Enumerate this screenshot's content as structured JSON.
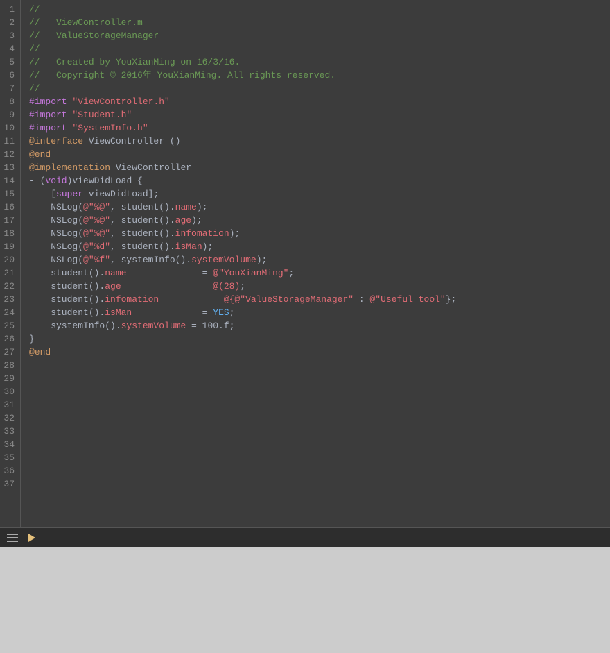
{
  "editor": {
    "background": "#3c3c3c",
    "lines": [
      {
        "num": 1,
        "tokens": [
          {
            "t": "//",
            "c": "comment"
          }
        ]
      },
      {
        "num": 2,
        "tokens": [
          {
            "t": "//   ViewController.m",
            "c": "comment"
          }
        ]
      },
      {
        "num": 3,
        "tokens": [
          {
            "t": "//   ValueStorageManager",
            "c": "comment"
          }
        ]
      },
      {
        "num": 4,
        "tokens": [
          {
            "t": "//",
            "c": "comment"
          }
        ]
      },
      {
        "num": 5,
        "tokens": [
          {
            "t": "//   Created by YouXianMing on 16/3/16.",
            "c": "comment"
          }
        ]
      },
      {
        "num": 6,
        "tokens": [
          {
            "t": "//   Copyright © 2016年 YouXianMing. All rights reserved.",
            "c": "comment"
          }
        ]
      },
      {
        "num": 7,
        "tokens": [
          {
            "t": "//",
            "c": "comment"
          }
        ]
      },
      {
        "num": 8,
        "tokens": [
          {
            "t": "",
            "c": "plain"
          }
        ]
      },
      {
        "num": 9,
        "tokens": [
          {
            "t": "#import",
            "c": "directive"
          },
          {
            "t": " ",
            "c": "plain"
          },
          {
            "t": "\"ViewController.h\"",
            "c": "string"
          }
        ]
      },
      {
        "num": 10,
        "tokens": [
          {
            "t": "#import",
            "c": "directive"
          },
          {
            "t": " ",
            "c": "plain"
          },
          {
            "t": "\"Student.h\"",
            "c": "string"
          }
        ]
      },
      {
        "num": 11,
        "tokens": [
          {
            "t": "#import",
            "c": "directive"
          },
          {
            "t": " ",
            "c": "plain"
          },
          {
            "t": "\"SystemInfo.h\"",
            "c": "string"
          }
        ]
      },
      {
        "num": 12,
        "tokens": [
          {
            "t": "",
            "c": "plain"
          }
        ]
      },
      {
        "num": 13,
        "tokens": [
          {
            "t": "@interface",
            "c": "keyword-at"
          },
          {
            "t": " ViewController ()",
            "c": "plain"
          }
        ]
      },
      {
        "num": 14,
        "tokens": [
          {
            "t": "",
            "c": "plain"
          }
        ]
      },
      {
        "num": 15,
        "tokens": [
          {
            "t": "@end",
            "c": "keyword-at"
          }
        ]
      },
      {
        "num": 16,
        "tokens": [
          {
            "t": "",
            "c": "plain"
          }
        ]
      },
      {
        "num": 17,
        "tokens": [
          {
            "t": "@implementation",
            "c": "keyword-at"
          },
          {
            "t": " ViewController",
            "c": "plain"
          }
        ]
      },
      {
        "num": 18,
        "tokens": [
          {
            "t": "",
            "c": "plain"
          }
        ]
      },
      {
        "num": 19,
        "tokens": [
          {
            "t": "- (",
            "c": "plain"
          },
          {
            "t": "void",
            "c": "keyword-pink"
          },
          {
            "t": ")viewDidLoad {",
            "c": "plain"
          }
        ]
      },
      {
        "num": 20,
        "tokens": [
          {
            "t": "",
            "c": "plain"
          }
        ]
      },
      {
        "num": 21,
        "tokens": [
          {
            "t": "    [",
            "c": "plain"
          },
          {
            "t": "super",
            "c": "keyword-pink"
          },
          {
            "t": " viewDidLoad];",
            "c": "plain"
          }
        ]
      },
      {
        "num": 22,
        "tokens": [
          {
            "t": "",
            "c": "plain"
          }
        ]
      },
      {
        "num": 23,
        "tokens": [
          {
            "t": "    NSLog(",
            "c": "plain"
          },
          {
            "t": "@\"%@\"",
            "c": "string"
          },
          {
            "t": ", student().",
            "c": "plain"
          },
          {
            "t": "name",
            "c": "property"
          },
          {
            "t": ");",
            "c": "plain"
          }
        ]
      },
      {
        "num": 24,
        "tokens": [
          {
            "t": "    NSLog(",
            "c": "plain"
          },
          {
            "t": "@\"%@\"",
            "c": "string"
          },
          {
            "t": ", student().",
            "c": "plain"
          },
          {
            "t": "age",
            "c": "property"
          },
          {
            "t": ");",
            "c": "plain"
          }
        ]
      },
      {
        "num": 25,
        "tokens": [
          {
            "t": "    NSLog(",
            "c": "plain"
          },
          {
            "t": "@\"%@\"",
            "c": "string"
          },
          {
            "t": ", student().",
            "c": "plain"
          },
          {
            "t": "infomation",
            "c": "property"
          },
          {
            "t": ");",
            "c": "plain"
          }
        ]
      },
      {
        "num": 26,
        "tokens": [
          {
            "t": "    NSLog(",
            "c": "plain"
          },
          {
            "t": "@\"%d\"",
            "c": "string"
          },
          {
            "t": ", student().",
            "c": "plain"
          },
          {
            "t": "isMan",
            "c": "property"
          },
          {
            "t": ");",
            "c": "plain"
          }
        ]
      },
      {
        "num": 27,
        "tokens": [
          {
            "t": "    NSLog(",
            "c": "plain"
          },
          {
            "t": "@\"%f\"",
            "c": "string"
          },
          {
            "t": ", systemInfo().",
            "c": "plain"
          },
          {
            "t": "systemVolume",
            "c": "property"
          },
          {
            "t": ");",
            "c": "plain"
          }
        ]
      },
      {
        "num": 28,
        "tokens": [
          {
            "t": "",
            "c": "plain"
          }
        ]
      },
      {
        "num": 29,
        "tokens": [
          {
            "t": "    student().",
            "c": "plain"
          },
          {
            "t": "name",
            "c": "property"
          },
          {
            "t": "              = ",
            "c": "plain"
          },
          {
            "t": "@\"YouXianMing\"",
            "c": "string"
          },
          {
            "t": ";",
            "c": "plain"
          }
        ]
      },
      {
        "num": 30,
        "tokens": [
          {
            "t": "    student().",
            "c": "plain"
          },
          {
            "t": "age",
            "c": "property"
          },
          {
            "t": "               = ",
            "c": "plain"
          },
          {
            "t": "@(28)",
            "c": "string"
          },
          {
            "t": ";",
            "c": "plain"
          }
        ]
      },
      {
        "num": 31,
        "tokens": [
          {
            "t": "    student().",
            "c": "plain"
          },
          {
            "t": "infomation",
            "c": "property"
          },
          {
            "t": "          = ",
            "c": "plain"
          },
          {
            "t": "@{@\"ValueStorageManager\"",
            "c": "string"
          },
          {
            "t": " : ",
            "c": "plain"
          },
          {
            "t": "@\"Useful tool\"",
            "c": "string"
          },
          {
            "t": "};",
            "c": "plain"
          }
        ]
      },
      {
        "num": 32,
        "tokens": [
          {
            "t": "    student().",
            "c": "plain"
          },
          {
            "t": "isMan",
            "c": "property"
          },
          {
            "t": "             = ",
            "c": "plain"
          },
          {
            "t": "YES",
            "c": "yes"
          },
          {
            "t": ";",
            "c": "plain"
          }
        ]
      },
      {
        "num": 33,
        "tokens": [
          {
            "t": "    systemInfo().",
            "c": "plain"
          },
          {
            "t": "systemVolume",
            "c": "property"
          },
          {
            "t": " = 100.f;",
            "c": "plain"
          }
        ]
      },
      {
        "num": 34,
        "tokens": [
          {
            "t": "}",
            "c": "plain"
          }
        ]
      },
      {
        "num": 35,
        "tokens": [
          {
            "t": "",
            "c": "plain"
          }
        ]
      },
      {
        "num": 36,
        "tokens": [
          {
            "t": "@end",
            "c": "keyword-at"
          }
        ]
      },
      {
        "num": 37,
        "tokens": [
          {
            "t": "",
            "c": "plain"
          }
        ]
      }
    ]
  },
  "toolbar": {
    "icon1": "≡",
    "icon2": "▶"
  }
}
